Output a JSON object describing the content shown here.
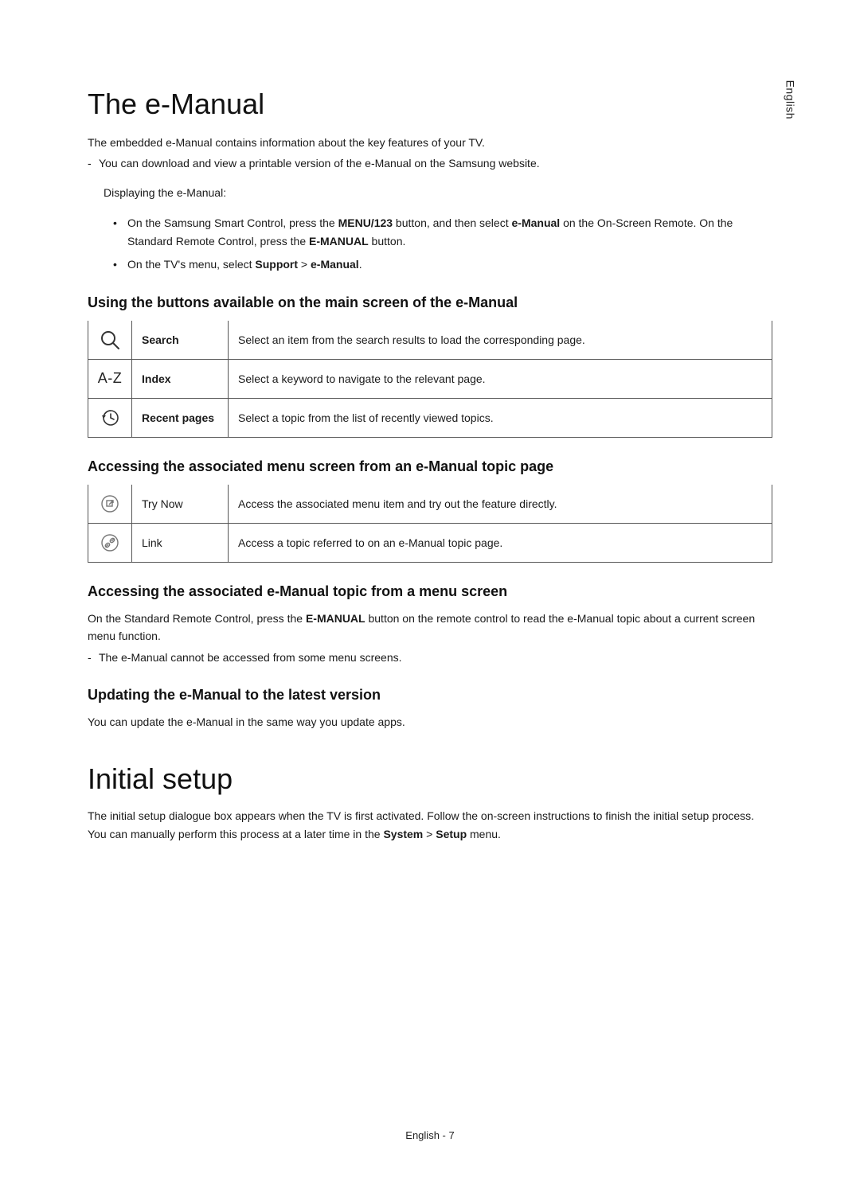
{
  "language_tab": "English",
  "section1": {
    "title": "The e-Manual",
    "intro": "The embedded e-Manual contains information about the key features of your TV.",
    "download_note": "You can download and view a printable version of the e-Manual on the Samsung website.",
    "display_label": "Displaying the e-Manual:",
    "bullet1_pre": "On the Samsung Smart Control, press the ",
    "bullet1_btn": "MENU/123",
    "bullet1_mid": " button, and then select ",
    "bullet1_em": "e-Manual",
    "bullet1_post_a": " on the On-Screen Remote. On the Standard Remote Control, press the ",
    "bullet1_em2": "E-MANUAL",
    "bullet1_post_b": " button.",
    "bullet2_pre": "On the TV's menu, select ",
    "bullet2_sup": "Support",
    "bullet2_gt": " > ",
    "bullet2_em": "e-Manual",
    "bullet2_post": "."
  },
  "sub1": {
    "heading": "Using the buttons available on the main screen of the e-Manual",
    "rows": [
      {
        "icon": "search",
        "label": "Search",
        "desc": "Select an item from the search results to load the corresponding page."
      },
      {
        "icon": "az",
        "label": "Index",
        "desc": "Select a keyword to navigate to the relevant page."
      },
      {
        "icon": "recent",
        "label": "Recent pages",
        "desc": "Select a topic from the list of recently viewed topics."
      }
    ]
  },
  "sub2": {
    "heading": "Accessing the associated menu screen from an e-Manual topic page",
    "rows": [
      {
        "icon": "trynow",
        "label": "Try Now",
        "desc": "Access the associated menu item and try out the feature directly."
      },
      {
        "icon": "link",
        "label": "Link",
        "desc": "Access a topic referred to on an e-Manual topic page."
      }
    ]
  },
  "sub3": {
    "heading": "Accessing the associated e-Manual topic from a menu screen",
    "line1_pre": "On the Standard Remote Control, press the ",
    "line1_btn": "E-MANUAL",
    "line1_post": " button on the remote control to read the e-Manual topic about a current screen menu function.",
    "note": "The e-Manual cannot be accessed from some menu screens."
  },
  "sub4": {
    "heading": "Updating the e-Manual to the latest version",
    "line": "You can update the e-Manual in the same way you update apps."
  },
  "section2": {
    "title": "Initial setup",
    "line_pre": "The initial setup dialogue box appears when the TV is first activated. Follow the on-screen instructions to finish the initial setup process. You can manually perform this process at a later time in the ",
    "sys": "System",
    "gt": " > ",
    "setup": "Setup",
    "post": " menu."
  },
  "footer": {
    "label": "English - 7"
  },
  "icon_az_text": "A-Z"
}
